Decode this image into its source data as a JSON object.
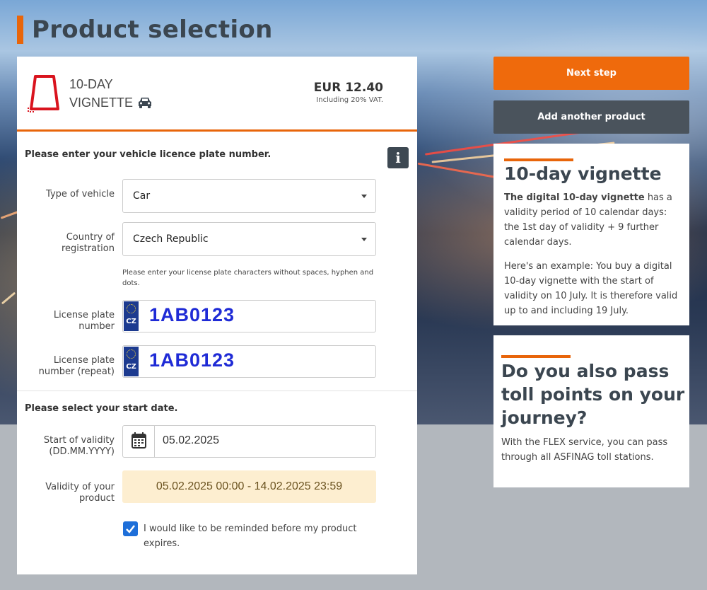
{
  "page": {
    "title": "Product selection"
  },
  "product": {
    "name_line1": "10-DAY",
    "name_line2": "VIGNETTE",
    "price": "EUR 12.40",
    "vat_note": "Including 20% VAT."
  },
  "form": {
    "plate_section_label": "Please enter your vehicle licence plate number.",
    "vehicle_type": {
      "label": "Type of vehicle",
      "value": "Car"
    },
    "country": {
      "label_line1": "Country of",
      "label_line2": "registration",
      "value": "Czech Republic"
    },
    "plate_hint": "Please enter your license plate characters without spaces, hyphen and dots.",
    "plate": {
      "label_line1": "License plate",
      "label_line2": "number",
      "country_code": "CZ",
      "value": "1AB0123"
    },
    "plate_repeat": {
      "label_line1": "License plate",
      "label_line2": "number (repeat)",
      "country_code": "CZ",
      "value": "1AB0123"
    },
    "date_section_label": "Please select your start date.",
    "start": {
      "label_line1": "Start of validity",
      "label_line2": "(DD.MM.YYYY)",
      "value": "05.02.2025"
    },
    "validity": {
      "label_line1": "Validity of your",
      "label_line2": "product",
      "value": "05.02.2025 00:00 - 14.02.2025 23:59"
    },
    "reminder": {
      "label": "I would like to be reminded before my product expires.",
      "checked": true
    }
  },
  "actions": {
    "next": "Next step",
    "add": "Add another product"
  },
  "info_box": {
    "title": "10-day vignette",
    "p1_bold": "The digital 10-day vignette",
    "p1_rest": " has a validity period of 10 calendar days: the 1st day of validity + 9 further calendar days.",
    "p2": "Here's an example: You buy a digital 10-day vignette with the start of validity on 10 July. It is therefore valid up to and including 19 July."
  },
  "toll_box": {
    "title": "Do you also pass toll points on your journey?",
    "text": "With the FLEX service, you can pass through all ASFINAG toll stations."
  },
  "colors": {
    "accent": "#e8650a",
    "dark": "#3b4650",
    "plate_text": "#1f2bd6",
    "checkbox": "#1e6fd9",
    "validity_bg": "#fdeed0"
  },
  "icons": {
    "vignette": "vignette-icon",
    "car": "car-icon",
    "info": "info-icon",
    "calendar": "calendar-icon",
    "caret": "chevron-down-icon",
    "check": "checkmark-icon"
  }
}
